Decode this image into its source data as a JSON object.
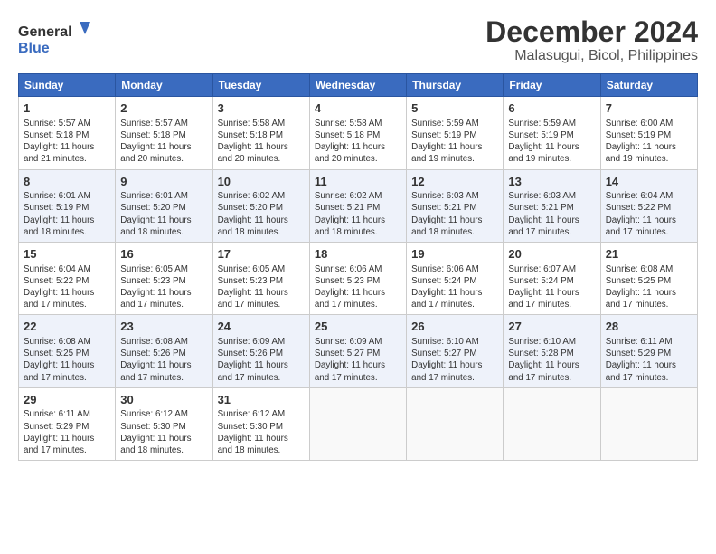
{
  "logo": {
    "line1": "General",
    "line2": "Blue"
  },
  "title": "December 2024",
  "subtitle": "Malasugui, Bicol, Philippines",
  "headers": [
    "Sunday",
    "Monday",
    "Tuesday",
    "Wednesday",
    "Thursday",
    "Friday",
    "Saturday"
  ],
  "weeks": [
    [
      {
        "day": "1",
        "detail": "Sunrise: 5:57 AM\nSunset: 5:18 PM\nDaylight: 11 hours\nand 21 minutes."
      },
      {
        "day": "2",
        "detail": "Sunrise: 5:57 AM\nSunset: 5:18 PM\nDaylight: 11 hours\nand 20 minutes."
      },
      {
        "day": "3",
        "detail": "Sunrise: 5:58 AM\nSunset: 5:18 PM\nDaylight: 11 hours\nand 20 minutes."
      },
      {
        "day": "4",
        "detail": "Sunrise: 5:58 AM\nSunset: 5:18 PM\nDaylight: 11 hours\nand 20 minutes."
      },
      {
        "day": "5",
        "detail": "Sunrise: 5:59 AM\nSunset: 5:19 PM\nDaylight: 11 hours\nand 19 minutes."
      },
      {
        "day": "6",
        "detail": "Sunrise: 5:59 AM\nSunset: 5:19 PM\nDaylight: 11 hours\nand 19 minutes."
      },
      {
        "day": "7",
        "detail": "Sunrise: 6:00 AM\nSunset: 5:19 PM\nDaylight: 11 hours\nand 19 minutes."
      }
    ],
    [
      {
        "day": "8",
        "detail": "Sunrise: 6:01 AM\nSunset: 5:19 PM\nDaylight: 11 hours\nand 18 minutes."
      },
      {
        "day": "9",
        "detail": "Sunrise: 6:01 AM\nSunset: 5:20 PM\nDaylight: 11 hours\nand 18 minutes."
      },
      {
        "day": "10",
        "detail": "Sunrise: 6:02 AM\nSunset: 5:20 PM\nDaylight: 11 hours\nand 18 minutes."
      },
      {
        "day": "11",
        "detail": "Sunrise: 6:02 AM\nSunset: 5:21 PM\nDaylight: 11 hours\nand 18 minutes."
      },
      {
        "day": "12",
        "detail": "Sunrise: 6:03 AM\nSunset: 5:21 PM\nDaylight: 11 hours\nand 18 minutes."
      },
      {
        "day": "13",
        "detail": "Sunrise: 6:03 AM\nSunset: 5:21 PM\nDaylight: 11 hours\nand 17 minutes."
      },
      {
        "day": "14",
        "detail": "Sunrise: 6:04 AM\nSunset: 5:22 PM\nDaylight: 11 hours\nand 17 minutes."
      }
    ],
    [
      {
        "day": "15",
        "detail": "Sunrise: 6:04 AM\nSunset: 5:22 PM\nDaylight: 11 hours\nand 17 minutes."
      },
      {
        "day": "16",
        "detail": "Sunrise: 6:05 AM\nSunset: 5:23 PM\nDaylight: 11 hours\nand 17 minutes."
      },
      {
        "day": "17",
        "detail": "Sunrise: 6:05 AM\nSunset: 5:23 PM\nDaylight: 11 hours\nand 17 minutes."
      },
      {
        "day": "18",
        "detail": "Sunrise: 6:06 AM\nSunset: 5:23 PM\nDaylight: 11 hours\nand 17 minutes."
      },
      {
        "day": "19",
        "detail": "Sunrise: 6:06 AM\nSunset: 5:24 PM\nDaylight: 11 hours\nand 17 minutes."
      },
      {
        "day": "20",
        "detail": "Sunrise: 6:07 AM\nSunset: 5:24 PM\nDaylight: 11 hours\nand 17 minutes."
      },
      {
        "day": "21",
        "detail": "Sunrise: 6:08 AM\nSunset: 5:25 PM\nDaylight: 11 hours\nand 17 minutes."
      }
    ],
    [
      {
        "day": "22",
        "detail": "Sunrise: 6:08 AM\nSunset: 5:25 PM\nDaylight: 11 hours\nand 17 minutes."
      },
      {
        "day": "23",
        "detail": "Sunrise: 6:08 AM\nSunset: 5:26 PM\nDaylight: 11 hours\nand 17 minutes."
      },
      {
        "day": "24",
        "detail": "Sunrise: 6:09 AM\nSunset: 5:26 PM\nDaylight: 11 hours\nand 17 minutes."
      },
      {
        "day": "25",
        "detail": "Sunrise: 6:09 AM\nSunset: 5:27 PM\nDaylight: 11 hours\nand 17 minutes."
      },
      {
        "day": "26",
        "detail": "Sunrise: 6:10 AM\nSunset: 5:27 PM\nDaylight: 11 hours\nand 17 minutes."
      },
      {
        "day": "27",
        "detail": "Sunrise: 6:10 AM\nSunset: 5:28 PM\nDaylight: 11 hours\nand 17 minutes."
      },
      {
        "day": "28",
        "detail": "Sunrise: 6:11 AM\nSunset: 5:29 PM\nDaylight: 11 hours\nand 17 minutes."
      }
    ],
    [
      {
        "day": "29",
        "detail": "Sunrise: 6:11 AM\nSunset: 5:29 PM\nDaylight: 11 hours\nand 17 minutes."
      },
      {
        "day": "30",
        "detail": "Sunrise: 6:12 AM\nSunset: 5:30 PM\nDaylight: 11 hours\nand 18 minutes."
      },
      {
        "day": "31",
        "detail": "Sunrise: 6:12 AM\nSunset: 5:30 PM\nDaylight: 11 hours\nand 18 minutes."
      },
      {
        "day": "",
        "detail": ""
      },
      {
        "day": "",
        "detail": ""
      },
      {
        "day": "",
        "detail": ""
      },
      {
        "day": "",
        "detail": ""
      }
    ]
  ]
}
